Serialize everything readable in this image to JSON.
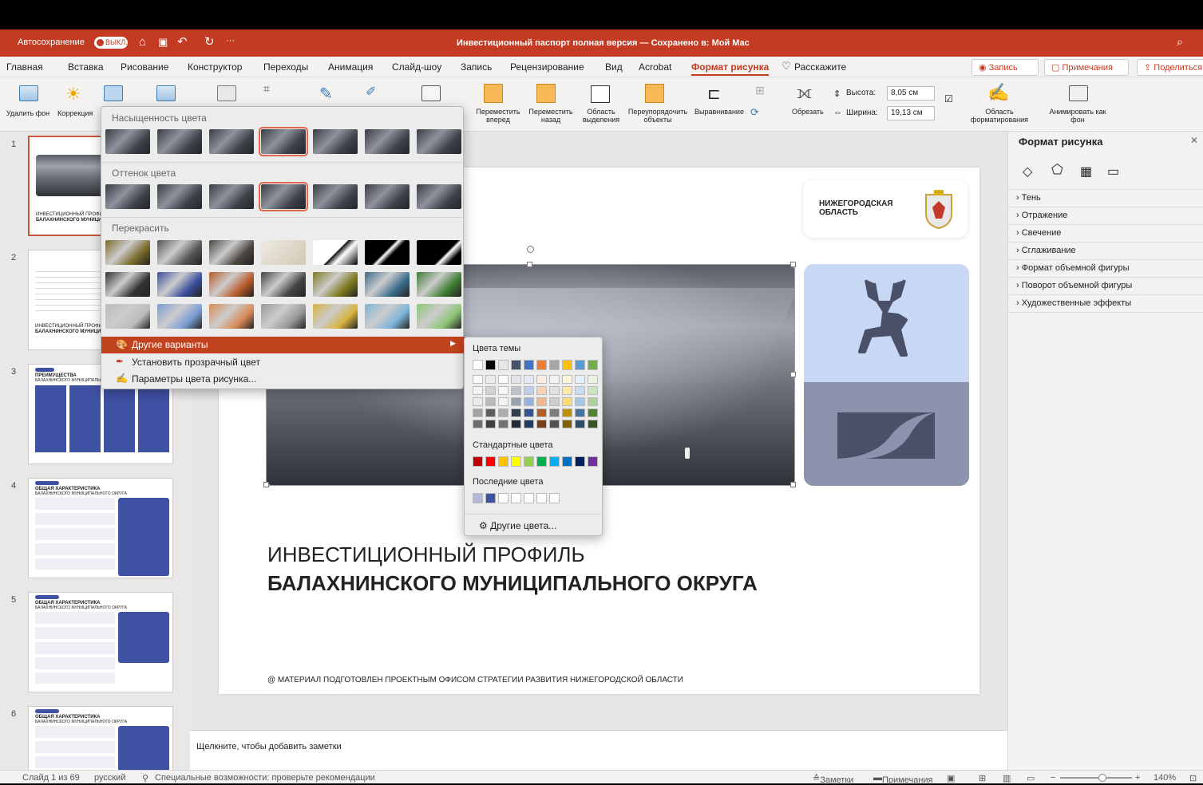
{
  "window": {
    "title": "Инвестиционный паспорт полная версия — Сохранено в: Мой Mac",
    "autosave_label": "Автосохранение",
    "autosave_state": "ВЫКЛ."
  },
  "menu": {
    "tabs": [
      "Главная",
      "Вставка",
      "Рисование",
      "Конструктор",
      "Переходы",
      "Анимация",
      "Слайд-шоу",
      "Запись",
      "Рецензирование",
      "Вид",
      "Acrobat",
      "Формат рисунка",
      "Расскажите"
    ],
    "record": "Запись",
    "comments": "Примечания",
    "share": "Поделиться"
  },
  "ribbon": {
    "remove_bg": "Удалить фон",
    "correction": "Коррекция",
    "bring_forward": "Переместить вперед",
    "send_back": "Переместить назад",
    "selection_pane": "Область выделения",
    "reorder": "Переупорядочить объекты",
    "align": "Выравнивание",
    "crop": "Обрезать",
    "height_label": "Высота:",
    "height_value": "8,05 см",
    "width_label": "Ширина:",
    "width_value": "19,13 см",
    "format_pane": "Область форматирования",
    "animate_bg": "Анимировать как фон"
  },
  "color_menu": {
    "saturation": "Насыщенность цвета",
    "tone": "Оттенок цвета",
    "recolor": "Перекрасить",
    "more_variants": "Другие варианты",
    "set_transparent": "Установить прозрачный цвет",
    "picture_color_options": "Параметры цвета рисунка..."
  },
  "submenu": {
    "theme_colors": "Цвета темы",
    "standard_colors": "Стандартные цвета",
    "recent_colors": "Последние цвета",
    "more_colors": "Другие цвета...",
    "theme_row": [
      "#ffffff",
      "#000000",
      "#e7e6e6",
      "#44546a",
      "#4472c4",
      "#ed7d31",
      "#a5a5a5",
      "#ffc000",
      "#5b9bd5",
      "#70ad47"
    ],
    "standard_row": [
      "#c00000",
      "#ff0000",
      "#ffc000",
      "#ffff00",
      "#92d050",
      "#00b050",
      "#00b0f0",
      "#0070c0",
      "#002060",
      "#7030a0"
    ],
    "recent_row": [
      "#b4b9d9",
      "#3f51a3",
      "#ffffff",
      "#ffffff",
      "#ffffff",
      "#ffffff",
      "#ffffff"
    ]
  },
  "thumbnails": {
    "numbers": [
      "1",
      "2",
      "3",
      "4",
      "5",
      "6"
    ],
    "t1_title": "ИНВЕСТИЦИОННЫЙ ПРОФИЛЬ",
    "t1_sub": "БАЛАХНИНСКОГО МУНИЦИПАЛЬНОГО ОКРУГА",
    "t3_title": "ПРЕИМУЩЕСТВА",
    "t3_sub": "БАЛАХНИНСКОГО МУНИЦИПАЛЬНОГО ОКРУГА",
    "t4_title": "ОБЩАЯ ХАРАКТЕРИСТИКА",
    "t4_sub": "БАЛАХНИНСКОГО МУНИЦИПАЛЬНОГО ОКРУГА"
  },
  "slide": {
    "region_line1": "НИЖЕГОРОДСКАЯ",
    "region_line2": "ОБЛАСТЬ",
    "title_line1": "ИНВЕСТИЦИОННЫЙ ПРОФИЛЬ",
    "title_line2": "БАЛАХНИНСКОГО МУНИЦИПАЛЬНОГО ОКРУГА",
    "footer": "@ МАТЕРИАЛ ПОДГОТОВЛЕН ПРОЕКТНЫМ ОФИСОМ СТРАТЕГИИ РАЗВИТИЯ НИЖЕГОРОДСКОЙ ОБЛАСТИ"
  },
  "notes": {
    "placeholder": "Щелкните, чтобы добавить заметки"
  },
  "format_pane": {
    "title": "Формат рисунка",
    "items": [
      "Тень",
      "Отражение",
      "Свечение",
      "Сглаживание",
      "Формат объемной фигуры",
      "Поворот объемной фигуры",
      "Художественные эффекты"
    ]
  },
  "status": {
    "slide": "Слайд 1 из 69",
    "language": "русский",
    "accessibility": "Специальные возможности: проверьте рекомендации",
    "notes": "Заметки",
    "comments": "Примечания",
    "zoom": "140%"
  }
}
